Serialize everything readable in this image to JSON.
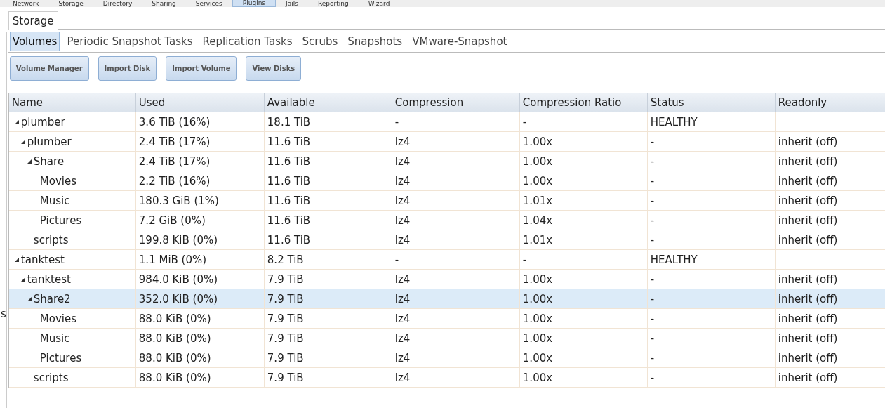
{
  "nav": [
    {
      "label": "Network",
      "selected": false
    },
    {
      "label": "Storage",
      "selected": false
    },
    {
      "label": "Directory",
      "selected": false
    },
    {
      "label": "Sharing",
      "selected": false
    },
    {
      "label": "Services",
      "selected": false
    },
    {
      "label": "Plugins",
      "selected": true
    },
    {
      "label": "Jails",
      "selected": false
    },
    {
      "label": "Reporting",
      "selected": false
    },
    {
      "label": "Wizard",
      "selected": false
    }
  ],
  "sidebar_fragment": "s",
  "tabs": [
    {
      "label": "Storage",
      "selected": true
    }
  ],
  "subtabs": [
    {
      "label": "Volumes",
      "selected": true
    },
    {
      "label": "Periodic Snapshot Tasks",
      "selected": false
    },
    {
      "label": "Replication Tasks",
      "selected": false
    },
    {
      "label": "Scrubs",
      "selected": false
    },
    {
      "label": "Snapshots",
      "selected": false
    },
    {
      "label": "VMware-Snapshot",
      "selected": false
    }
  ],
  "buttons": [
    "Volume Manager",
    "Import Disk",
    "Import Volume",
    "View Disks"
  ],
  "table": {
    "columns": [
      "Name",
      "Used",
      "Available",
      "Compression",
      "Compression Ratio",
      "Status",
      "Readonly"
    ],
    "rows": [
      {
        "name": "plumber",
        "used": "3.6 TiB (16%)",
        "available": "18.1 TiB",
        "compression": "-",
        "compression_ratio": "-",
        "status": "HEALTHY",
        "selected": false,
        "expanded": true,
        "children": [
          {
            "name": "plumber",
            "used": "2.4 TiB (17%)",
            "available": "11.6 TiB",
            "compression": "lz4",
            "compression_ratio": "1.00x",
            "status": "-",
            "readonly": "inherit (off)",
            "selected": false,
            "expanded": true,
            "children": [
              {
                "name": "Share",
                "used": "2.4 TiB (17%)",
                "available": "11.6 TiB",
                "compression": "lz4",
                "compression_ratio": "1.00x",
                "status": "-",
                "readonly": "inherit (off)",
                "selected": false,
                "expanded": true,
                "children": [
                  {
                    "name": "Movies",
                    "used": "2.2 TiB (16%)",
                    "available": "11.6 TiB",
                    "compression": "lz4",
                    "compression_ratio": "1.00x",
                    "status": "-",
                    "readonly": "inherit (off)",
                    "selected": false
                  },
                  {
                    "name": "Music",
                    "used": "180.3 GiB (1%)",
                    "available": "11.6 TiB",
                    "compression": "lz4",
                    "compression_ratio": "1.01x",
                    "status": "-",
                    "readonly": "inherit (off)",
                    "selected": false
                  },
                  {
                    "name": "Pictures",
                    "used": "7.2 GiB (0%)",
                    "available": "11.6 TiB",
                    "compression": "lz4",
                    "compression_ratio": "1.04x",
                    "status": "-",
                    "readonly": "inherit (off)",
                    "selected": false
                  }
                ]
              },
              {
                "name": "scripts",
                "used": "199.8 KiB (0%)",
                "available": "11.6 TiB",
                "compression": "lz4",
                "compression_ratio": "1.01x",
                "status": "-",
                "readonly": "inherit (off)",
                "selected": false
              }
            ]
          }
        ]
      },
      {
        "name": "tanktest",
        "used": "1.1 MiB (0%)",
        "available": "8.2 TiB",
        "compression": "-",
        "compression_ratio": "-",
        "status": "HEALTHY",
        "selected": false,
        "expanded": true,
        "children": [
          {
            "name": "tanktest",
            "used": "984.0 KiB (0%)",
            "available": "7.9 TiB",
            "compression": "lz4",
            "compression_ratio": "1.00x",
            "status": "-",
            "readonly": "inherit (off)",
            "selected": false,
            "expanded": true,
            "children": [
              {
                "name": "Share2",
                "used": "352.0 KiB (0%)",
                "available": "7.9 TiB",
                "compression": "lz4",
                "compression_ratio": "1.00x",
                "status": "-",
                "readonly": "inherit (off)",
                "selected": true,
                "expanded": true,
                "children": [
                  {
                    "name": "Movies",
                    "used": "88.0 KiB (0%)",
                    "available": "7.9 TiB",
                    "compression": "lz4",
                    "compression_ratio": "1.00x",
                    "status": "-",
                    "readonly": "inherit (off)",
                    "selected": false
                  },
                  {
                    "name": "Music",
                    "used": "88.0 KiB (0%)",
                    "available": "7.9 TiB",
                    "compression": "lz4",
                    "compression_ratio": "1.00x",
                    "status": "-",
                    "readonly": "inherit (off)",
                    "selected": false
                  },
                  {
                    "name": "Pictures",
                    "used": "88.0 KiB (0%)",
                    "available": "7.9 TiB",
                    "compression": "lz4",
                    "compression_ratio": "1.00x",
                    "status": "-",
                    "readonly": "inherit (off)",
                    "selected": false
                  }
                ]
              },
              {
                "name": "scripts",
                "used": "88.0 KiB (0%)",
                "available": "7.9 TiB",
                "compression": "lz4",
                "compression_ratio": "1.00x",
                "status": "-",
                "readonly": "inherit (off)",
                "selected": false
              }
            ]
          }
        ]
      }
    ]
  }
}
